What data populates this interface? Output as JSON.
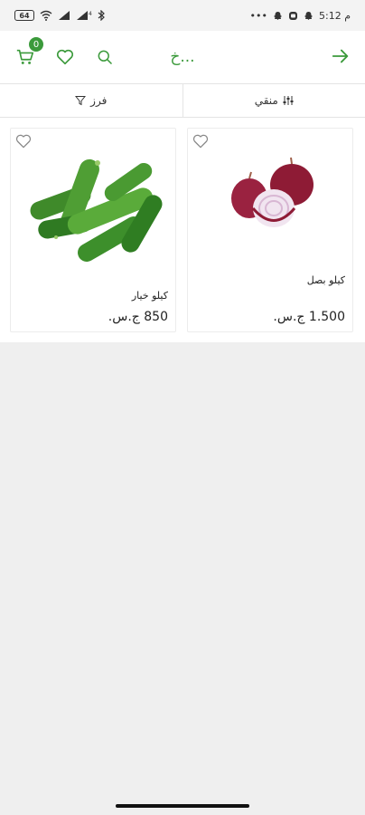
{
  "status_bar": {
    "time": "5:12 م",
    "battery": "64"
  },
  "header": {
    "title": "خ...",
    "cart_count": "0"
  },
  "filter_bar": {
    "sort_label": "فرز",
    "filter_label": "منقي"
  },
  "products": [
    {
      "name": "كيلو بصل",
      "price": "1.500 ج.س.",
      "image": "red-onion"
    },
    {
      "name": "كيلو خيار",
      "price": "850 ج.س.",
      "image": "cucumbers"
    }
  ],
  "colors": {
    "accent": "#3b9a3b",
    "background": "#efefef"
  }
}
